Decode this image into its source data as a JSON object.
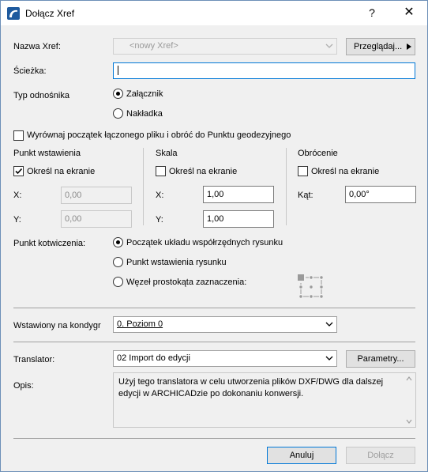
{
  "window": {
    "title": "Dołącz Xref",
    "help": "?",
    "close": "✕"
  },
  "xref": {
    "name_label": "Nazwa Xref:",
    "name_value": "<nowy Xref>",
    "browse_button": "Przeglądaj..."
  },
  "path": {
    "label": "Ścieżka:",
    "value": ""
  },
  "ref_type": {
    "label": "Typ odnośnika",
    "options": [
      "Załącznik",
      "Nakładka"
    ],
    "selected": 0
  },
  "align_checkbox": {
    "label": "Wyrównaj początek łączonego pliku i obróć do Punktu geodezyjnego",
    "checked": false
  },
  "insertion": {
    "heading": "Punkt wstawienia",
    "specify_label": "Określ na ekranie",
    "specify_checked": true,
    "x_label": "X:",
    "x_value": "0,00",
    "y_label": "Y:",
    "y_value": "0,00"
  },
  "scale": {
    "heading": "Skala",
    "specify_label": "Określ na ekranie",
    "specify_checked": false,
    "x_label": "X:",
    "x_value": "1,00",
    "y_label": "Y:",
    "y_value": "1,00"
  },
  "rotation": {
    "heading": "Obrócenie",
    "specify_label": "Określ na ekranie",
    "specify_checked": false,
    "angle_label": "Kąt:",
    "angle_value": "0,00°"
  },
  "anchor": {
    "label": "Punkt kotwiczenia:",
    "options": [
      "Początek układu współrzędnych rysunku",
      "Punkt wstawienia rysunku",
      "Węzeł prostokąta zaznaczenia:"
    ],
    "selected": 0
  },
  "story": {
    "label": "Wstawiony na kondygr",
    "value": "0. Poziom 0"
  },
  "translator": {
    "label": "Translator:",
    "value": "02 Import do edycji",
    "params_button": "Parametry..."
  },
  "description": {
    "label": "Opis:",
    "text": "Użyj tego translatora w celu utworzenia plików DXF/DWG dla dalszej edycji w ARCHICADzie po dokonaniu konwersji."
  },
  "footer": {
    "cancel": "Anuluj",
    "attach": "Dołącz"
  },
  "colors": {
    "accent": "#0078d7",
    "icon": "#1e5a9e"
  }
}
